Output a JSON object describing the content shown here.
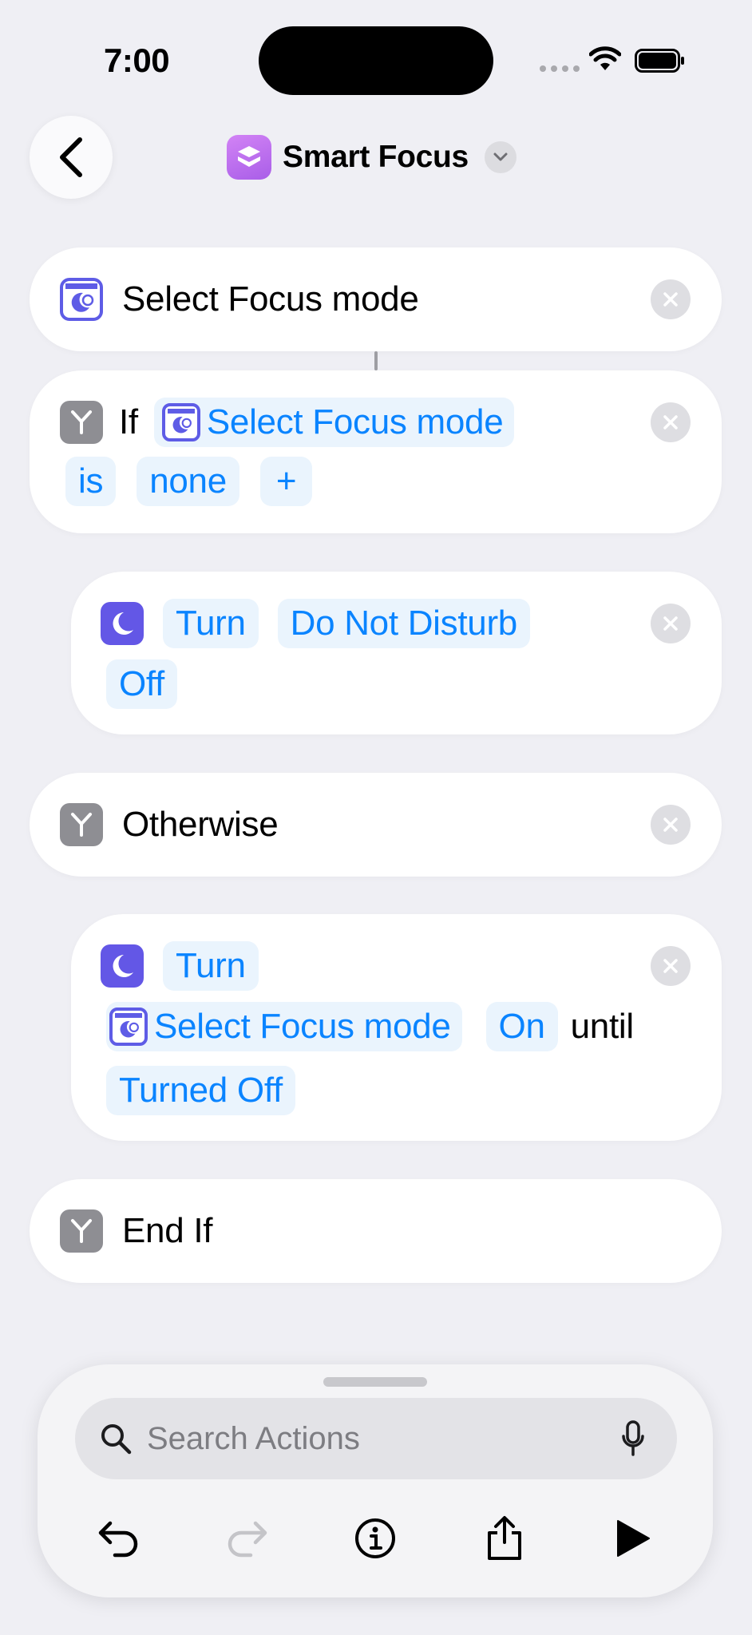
{
  "status": {
    "time": "7:00"
  },
  "header": {
    "title": "Smart Focus"
  },
  "actions": {
    "select_focus": {
      "label": "Select Focus mode"
    },
    "if_block": {
      "keyword": "If",
      "variable": "Select Focus mode",
      "operator": "is",
      "value": "none",
      "add": "+"
    },
    "turn_dnd": {
      "verb": "Turn",
      "mode": "Do Not Disturb",
      "state": "Off"
    },
    "otherwise": {
      "label": "Otherwise"
    },
    "turn_focus": {
      "verb": "Turn",
      "variable": "Select Focus mode",
      "state": "On",
      "until_word": "until",
      "until_value": "Turned Off"
    },
    "end_if": {
      "label": "End If"
    }
  },
  "bottom_sheet": {
    "search_placeholder": "Search Actions"
  },
  "colors": {
    "accent": "#0a84ff",
    "chip_bg": "#eaf4fd",
    "focus_purple": "#5e5ce6",
    "app_icon": "#b76af0"
  }
}
